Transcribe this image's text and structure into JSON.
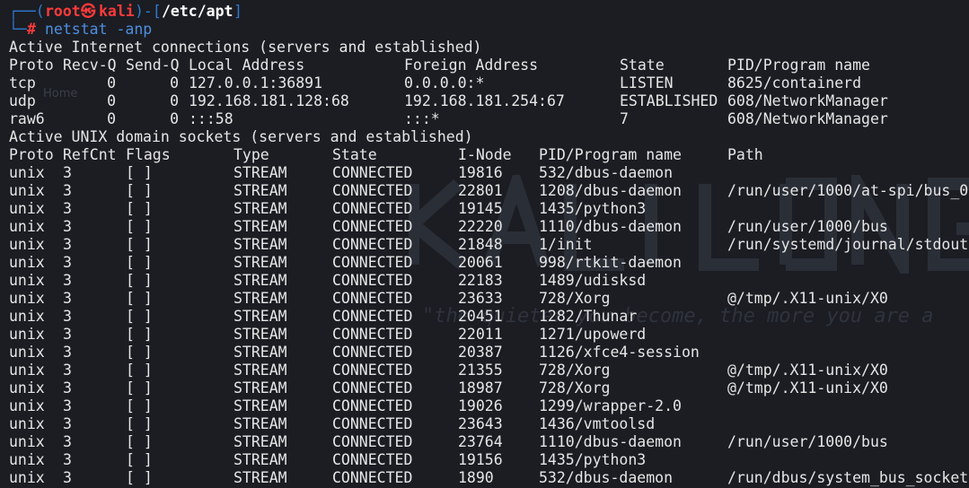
{
  "prompt": {
    "open": "┌──(",
    "user": "root",
    "at_glyph": "㉿",
    "host": "kali",
    "sep": ")-[",
    "path": "/etc/apt",
    "close": "]",
    "corner": "└─",
    "hash": "#",
    "command": "netstat -anp"
  },
  "watermark": {
    "home_label": "Home",
    "quote": "\"the quieter you become, the more you are a"
  },
  "inet": {
    "title": "Active Internet connections (servers and established)",
    "headers": [
      "Proto",
      "Recv-Q",
      "Send-Q",
      "Local Address",
      "Foreign Address",
      "State",
      "PID/Program name"
    ],
    "rows": [
      [
        "tcp",
        "0",
        "0",
        "127.0.0.1:36891",
        "0.0.0.0:*",
        "LISTEN",
        "8625/containerd"
      ],
      [
        "udp",
        "0",
        "0",
        "192.168.181.128:68",
        "192.168.181.254:67",
        "ESTABLISHED",
        "608/NetworkManager"
      ],
      [
        "raw6",
        "0",
        "0",
        ":::58",
        ":::*",
        "7",
        "608/NetworkManager"
      ]
    ]
  },
  "unix": {
    "title": "Active UNIX domain sockets (servers and established)",
    "headers": [
      "Proto",
      "RefCnt",
      "Flags",
      "Type",
      "State",
      "I-Node",
      "PID/Program name",
      "Path"
    ],
    "rows": [
      [
        "unix",
        "3",
        "[ ]",
        "STREAM",
        "CONNECTED",
        "19816",
        "532/dbus-daemon",
        ""
      ],
      [
        "unix",
        "3",
        "[ ]",
        "STREAM",
        "CONNECTED",
        "22801",
        "1208/dbus-daemon",
        "/run/user/1000/at-spi/bus_0"
      ],
      [
        "unix",
        "3",
        "[ ]",
        "STREAM",
        "CONNECTED",
        "19145",
        "1435/python3",
        ""
      ],
      [
        "unix",
        "3",
        "[ ]",
        "STREAM",
        "CONNECTED",
        "22220",
        "1110/dbus-daemon",
        "/run/user/1000/bus"
      ],
      [
        "unix",
        "3",
        "[ ]",
        "STREAM",
        "CONNECTED",
        "21848",
        "1/init",
        "/run/systemd/journal/stdout"
      ],
      [
        "unix",
        "3",
        "[ ]",
        "STREAM",
        "CONNECTED",
        "20061",
        "998/rtkit-daemon",
        ""
      ],
      [
        "unix",
        "3",
        "[ ]",
        "STREAM",
        "CONNECTED",
        "22183",
        "1489/udisksd",
        ""
      ],
      [
        "unix",
        "3",
        "[ ]",
        "STREAM",
        "CONNECTED",
        "23633",
        "728/Xorg",
        "@/tmp/.X11-unix/X0"
      ],
      [
        "unix",
        "3",
        "[ ]",
        "STREAM",
        "CONNECTED",
        "20451",
        "1282/Thunar",
        ""
      ],
      [
        "unix",
        "3",
        "[ ]",
        "STREAM",
        "CONNECTED",
        "22011",
        "1271/upowerd",
        ""
      ],
      [
        "unix",
        "3",
        "[ ]",
        "STREAM",
        "CONNECTED",
        "20387",
        "1126/xfce4-session",
        ""
      ],
      [
        "unix",
        "3",
        "[ ]",
        "STREAM",
        "CONNECTED",
        "21355",
        "728/Xorg",
        "@/tmp/.X11-unix/X0"
      ],
      [
        "unix",
        "3",
        "[ ]",
        "STREAM",
        "CONNECTED",
        "18987",
        "728/Xorg",
        "@/tmp/.X11-unix/X0"
      ],
      [
        "unix",
        "3",
        "[ ]",
        "STREAM",
        "CONNECTED",
        "19026",
        "1299/wrapper-2.0",
        ""
      ],
      [
        "unix",
        "3",
        "[ ]",
        "STREAM",
        "CONNECTED",
        "23643",
        "1436/vmtoolsd",
        ""
      ],
      [
        "unix",
        "3",
        "[ ]",
        "STREAM",
        "CONNECTED",
        "23764",
        "1110/dbus-daemon",
        "/run/user/1000/bus"
      ],
      [
        "unix",
        "3",
        "[ ]",
        "STREAM",
        "CONNECTED",
        "19156",
        "1435/python3",
        ""
      ],
      [
        "unix",
        "3",
        "[ ]",
        "STREAM",
        "CONNECTED",
        "1890",
        "532/dbus-daemon",
        "/run/dbus/system_bus_socket"
      ]
    ]
  }
}
